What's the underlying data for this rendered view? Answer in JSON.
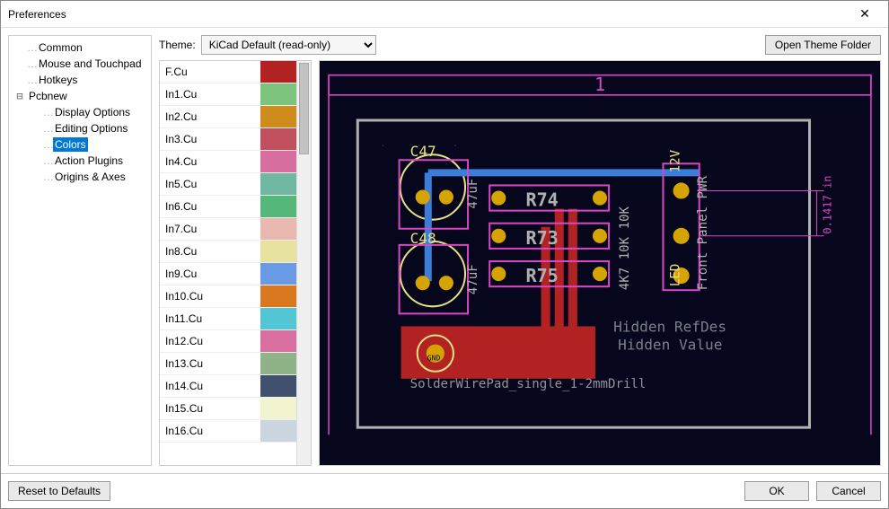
{
  "window": {
    "title": "Preferences"
  },
  "tree": {
    "items": [
      {
        "label": "Common",
        "indent": 1
      },
      {
        "label": "Mouse and Touchpad",
        "indent": 1
      },
      {
        "label": "Hotkeys",
        "indent": 1
      },
      {
        "label": "Pcbnew",
        "indent": 0,
        "expander": "⊟"
      },
      {
        "label": "Display Options",
        "indent": 2
      },
      {
        "label": "Editing Options",
        "indent": 2
      },
      {
        "label": "Colors",
        "indent": 2,
        "selected": true
      },
      {
        "label": "Action Plugins",
        "indent": 2
      },
      {
        "label": "Origins & Axes",
        "indent": 2
      }
    ]
  },
  "theme": {
    "label": "Theme:",
    "value": "KiCad Default (read-only)"
  },
  "open_theme_folder": "Open Theme Folder",
  "layers": [
    {
      "name": "F.Cu",
      "color": "#b22222"
    },
    {
      "name": "In1.Cu",
      "color": "#7cc47c"
    },
    {
      "name": "In2.Cu",
      "color": "#cf8b1b"
    },
    {
      "name": "In3.Cu",
      "color": "#c24f5d"
    },
    {
      "name": "In4.Cu",
      "color": "#d66fa0"
    },
    {
      "name": "In5.Cu",
      "color": "#6fb7a0"
    },
    {
      "name": "In6.Cu",
      "color": "#55b77a"
    },
    {
      "name": "In7.Cu",
      "color": "#e9b8b1"
    },
    {
      "name": "In8.Cu",
      "color": "#e7e29f"
    },
    {
      "name": "In9.Cu",
      "color": "#6a9ae3"
    },
    {
      "name": "In10.Cu",
      "color": "#d9781f"
    },
    {
      "name": "In11.Cu",
      "color": "#53c6d6"
    },
    {
      "name": "In12.Cu",
      "color": "#d96fa0"
    },
    {
      "name": "In13.Cu",
      "color": "#8fb386"
    },
    {
      "name": "In14.Cu",
      "color": "#41506d"
    },
    {
      "name": "In15.Cu",
      "color": "#f2f4cf"
    },
    {
      "name": "In16.Cu",
      "color": "#cad5df"
    }
  ],
  "preview": {
    "page_number": "1",
    "refdes1": "C47",
    "refdes2": "C48",
    "val1": "47uF",
    "val2": "47uF",
    "r1": "R74",
    "r2": "R73",
    "r3": "R75",
    "rvals": "4K7 10K 10K",
    "net12v": "12V",
    "netled": "LED",
    "netfppwr": "Front Panel PWR",
    "gnd": "GND",
    "hidden1": "Hidden RefDes",
    "hidden2": "Hidden Value",
    "footprint": "SolderWirePad_single_1-2mmDrill",
    "measure": "0.1417 in"
  },
  "footer": {
    "reset": "Reset to Defaults",
    "ok": "OK",
    "cancel": "Cancel"
  }
}
